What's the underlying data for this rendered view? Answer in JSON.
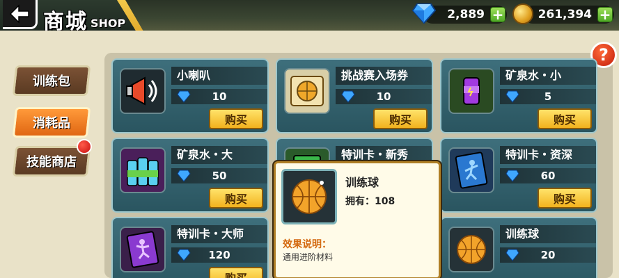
{
  "header": {
    "back_icon": "back-arrow-icon",
    "title_cn": "商城",
    "title_en": "SHOP"
  },
  "currency": {
    "gems": "2,889",
    "coins": "261,394",
    "plus": "+"
  },
  "help": "?",
  "tabs": [
    {
      "label": "训练包",
      "active": false
    },
    {
      "label": "消耗品",
      "active": true
    },
    {
      "label": "技能商店",
      "active": false,
      "has_badge": true
    }
  ],
  "items": [
    {
      "name": "小喇叭",
      "price": "10",
      "buy": "购买",
      "icon": "megaphone-icon"
    },
    {
      "name": "挑战赛入场券",
      "price": "10",
      "buy": "购买",
      "icon": "ticket-icon"
    },
    {
      "name": "矿泉水・小",
      "price": "5",
      "buy": "购买",
      "icon": "water-can-icon"
    },
    {
      "name": "矿泉水・大",
      "price": "50",
      "buy": "购买",
      "icon": "water-bottles-icon"
    },
    {
      "name": "特训卡・新秀",
      "price": "",
      "buy": "",
      "icon": "training-card-green-icon"
    },
    {
      "name": "特训卡・资深",
      "price": "60",
      "buy": "购买",
      "icon": "training-card-blue-icon"
    },
    {
      "name": "特训卡・大师",
      "price": "120",
      "buy": "购买",
      "icon": "training-card-purple-icon"
    },
    {
      "name": "",
      "price": "",
      "buy": "",
      "icon": ""
    },
    {
      "name": "训练球",
      "price": "20",
      "buy": "",
      "icon": "basketball-icon"
    }
  ],
  "popup": {
    "name": "训练球",
    "owned": "拥有：108",
    "effect_title": "效果说明：",
    "effect_desc": "通用进阶材料",
    "icon": "basketball-icon"
  },
  "colors": {
    "gem": "#3fa7ff",
    "coin": "#f0b42a",
    "buy_button": "#f7c83a",
    "active_tab": "#f07f1e",
    "card": "#356370"
  }
}
